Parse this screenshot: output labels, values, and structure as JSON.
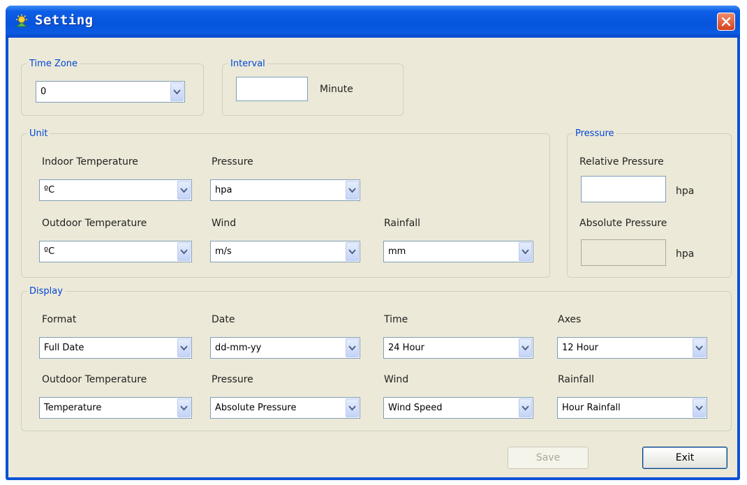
{
  "window": {
    "title": "Setting"
  },
  "time_zone": {
    "legend": "Time Zone",
    "value": "0"
  },
  "interval": {
    "legend": "Interval",
    "value": "",
    "unit": "Minute"
  },
  "unit": {
    "legend": "Unit",
    "indoor_temperature": {
      "label": "Indoor Temperature",
      "value": "ºC"
    },
    "pressure": {
      "label": "Pressure",
      "value": "hpa"
    },
    "outdoor_temperature": {
      "label": "Outdoor Temperature",
      "value": "ºC"
    },
    "wind": {
      "label": "Wind",
      "value": "m/s"
    },
    "rainfall": {
      "label": "Rainfall",
      "value": "mm"
    }
  },
  "pressure": {
    "legend": "Pressure",
    "relative": {
      "label": "Relative Pressure",
      "value": "",
      "unit": "hpa"
    },
    "absolute": {
      "label": "Absolute Pressure",
      "value": "",
      "unit": "hpa"
    }
  },
  "display": {
    "legend": "Display",
    "format": {
      "label": "Format",
      "value": "Full Date"
    },
    "date": {
      "label": "Date",
      "value": "dd-mm-yy"
    },
    "time": {
      "label": "Time",
      "value": "24 Hour"
    },
    "axes": {
      "label": "Axes",
      "value": "12 Hour"
    },
    "outdoor_temperature": {
      "label": "Outdoor Temperature",
      "value": "Temperature"
    },
    "pressure": {
      "label": "Pressure",
      "value": "Absolute Pressure"
    },
    "wind": {
      "label": "Wind",
      "value": "Wind Speed"
    },
    "rainfall": {
      "label": "Rainfall",
      "value": "Hour Rainfall"
    }
  },
  "buttons": {
    "save": "Save",
    "exit": "Exit"
  },
  "icons": {
    "app": "weather-station-icon",
    "close": "close-icon",
    "dropdown": "chevron-down-icon"
  },
  "colors": {
    "title_bar": "#0a52d6",
    "group_legend": "#0046d5",
    "dialog_bg": "#ece9d8",
    "close_button": "#d7411c"
  }
}
